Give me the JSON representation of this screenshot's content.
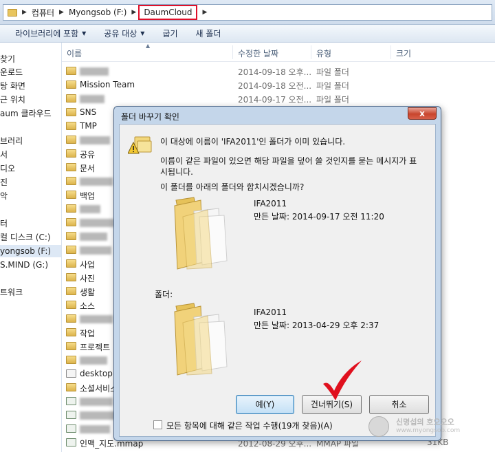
{
  "address": {
    "crumbs": [
      "컴퓨터",
      "Myongsob (F:)",
      "DaumCloud"
    ]
  },
  "toolbar": {
    "items": [
      "라이브러리에 포함",
      "공유 대상",
      "굽기",
      "새 폴더"
    ]
  },
  "nav": {
    "items": [
      "찾기",
      "운로드",
      "탕 화면",
      "근 위치",
      "aum 클라우드",
      "브러리",
      "서",
      "디오",
      "진",
      "악",
      "터",
      "컬 디스크 (C:)",
      "yongsob (F:)",
      "S.MIND (G:)",
      "트워크"
    ]
  },
  "columns": {
    "name": "이름",
    "date": "수정한 날짜",
    "type": "유형",
    "size": "크기"
  },
  "files": [
    {
      "name": "",
      "date": "2014-09-18 오후...",
      "type": "파일 폴더",
      "size": ""
    },
    {
      "name": "Mission Team",
      "date": "2014-09-18 오전...",
      "type": "파일 폴더",
      "size": ""
    },
    {
      "name": "",
      "date": "2014-09-17 오전...",
      "type": "파일 폴더",
      "size": ""
    },
    {
      "name": "SNS",
      "date": "",
      "type": "",
      "size": ""
    },
    {
      "name": "TMP",
      "date": "",
      "type": "",
      "size": ""
    },
    {
      "name": "",
      "date": "",
      "type": "",
      "size": ""
    },
    {
      "name": "공유",
      "date": "",
      "type": "",
      "size": ""
    },
    {
      "name": "문서",
      "date": "",
      "type": "",
      "size": ""
    },
    {
      "name": "",
      "date": "",
      "type": "",
      "size": ""
    },
    {
      "name": "백업",
      "date": "",
      "type": "",
      "size": ""
    },
    {
      "name": "",
      "date": "",
      "type": "",
      "size": ""
    },
    {
      "name": "",
      "date": "",
      "type": "",
      "size": ""
    },
    {
      "name": "",
      "date": "",
      "type": "",
      "size": ""
    },
    {
      "name": "",
      "date": "",
      "type": "",
      "size": ""
    },
    {
      "name": "사업",
      "date": "",
      "type": "",
      "size": ""
    },
    {
      "name": "사진",
      "date": "",
      "type": "",
      "size": ""
    },
    {
      "name": "생활",
      "date": "",
      "type": "",
      "size": ""
    },
    {
      "name": "소스",
      "date": "",
      "type": "",
      "size": ""
    },
    {
      "name": "",
      "date": "",
      "type": "",
      "size": ""
    },
    {
      "name": "작업",
      "date": "",
      "type": "",
      "size": ""
    },
    {
      "name": "프로젝트",
      "date": "",
      "type": "",
      "size": ""
    },
    {
      "name": "",
      "date": "",
      "type": "",
      "size": ""
    },
    {
      "name": "desktop.in",
      "date": "",
      "type": "",
      "size": ""
    },
    {
      "name": "소셜서비스",
      "date": "",
      "type": "",
      "size": ""
    },
    {
      "name": "",
      "date": "",
      "type": "",
      "size": ""
    },
    {
      "name": "",
      "date": "",
      "type": "",
      "size": ""
    },
    {
      "name": "",
      "date": "",
      "type": "",
      "size": ""
    },
    {
      "name": "인맥_지도.mmap",
      "date": "2012-08-29 오후...",
      "type": "MMAP 파일",
      "size": "31KB"
    }
  ],
  "dialog": {
    "title": "폴더 바꾸기 확인",
    "close": "x",
    "message": "이 대상에 이름이 'IFA2011'인 폴더가 이미 있습니다.",
    "info_line1": "이름이 같은 파일이 있으면 해당 파일을 덮어 쓸 것인지를 묻는 메시지가 표",
    "info_line2": "시됩니다.",
    "question": "이 폴더를 아래의 폴더와 합치시겠습니까?",
    "source": {
      "name": "IFA2011",
      "date": "만든 날짜: 2014-09-17 오전 11:20"
    },
    "target_label": "폴더:",
    "target": {
      "name": "IFA2011",
      "date": "만든 날짜: 2013-04-29 오후 2:37"
    },
    "buttons": {
      "yes": "예(Y)",
      "skip": "건너뛰기(S)",
      "cancel": "취소"
    },
    "checkbox_label": "모든 항목에 대해 같은 작업 수행(19개 찾음)(A)"
  },
  "watermark": {
    "line1": "신명섭의 호오오오",
    "line2": "www.myongsob.com"
  },
  "colors": {
    "highlight_box": "#e0102a",
    "checkmark": "#e0101e"
  }
}
